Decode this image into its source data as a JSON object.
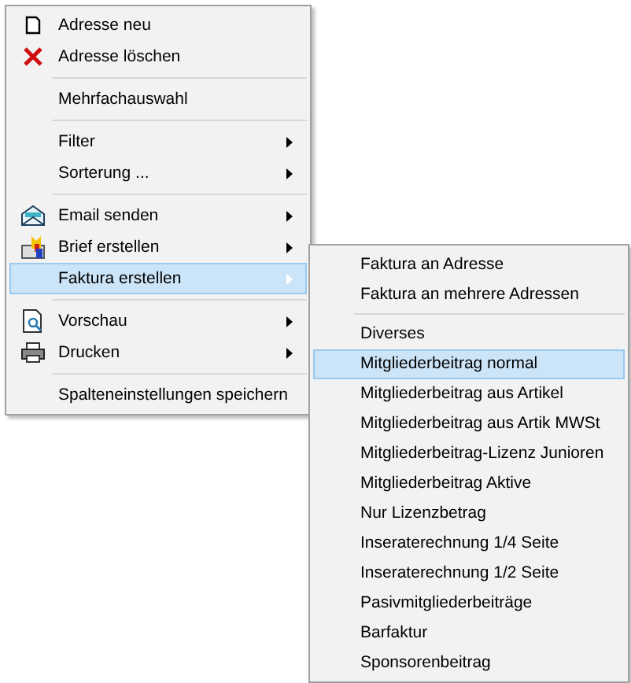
{
  "menu": {
    "items": [
      {
        "kind": "item",
        "label": "Adresse neu",
        "has_submenu": false,
        "selected": false
      },
      {
        "kind": "item",
        "label": "Adresse löschen",
        "has_submenu": false,
        "selected": false
      },
      {
        "kind": "separator"
      },
      {
        "kind": "item",
        "label": "Mehrfachauswahl",
        "has_submenu": false,
        "selected": false
      },
      {
        "kind": "separator"
      },
      {
        "kind": "item",
        "label": "Filter",
        "has_submenu": true,
        "selected": false
      },
      {
        "kind": "item",
        "label": "Sorterung ...",
        "has_submenu": true,
        "selected": false
      },
      {
        "kind": "separator"
      },
      {
        "kind": "item",
        "label": "Email senden",
        "has_submenu": true,
        "selected": false
      },
      {
        "kind": "item",
        "label": "Brief erstellen",
        "has_submenu": true,
        "selected": false
      },
      {
        "kind": "item",
        "label": "Faktura erstellen",
        "has_submenu": true,
        "selected": true
      },
      {
        "kind": "separator"
      },
      {
        "kind": "item",
        "label": "Vorschau",
        "has_submenu": true,
        "selected": false
      },
      {
        "kind": "item",
        "label": "Drucken",
        "has_submenu": true,
        "selected": false
      },
      {
        "kind": "separator"
      },
      {
        "kind": "item",
        "label": "Spalteneinstellungen speichern",
        "has_submenu": false,
        "selected": false
      }
    ]
  },
  "submenu": {
    "items": [
      {
        "kind": "item",
        "label": "Faktura an Adresse",
        "selected": false
      },
      {
        "kind": "item",
        "label": "Faktura an mehrere Adressen",
        "selected": false
      },
      {
        "kind": "separator"
      },
      {
        "kind": "item",
        "label": "Diverses",
        "selected": false
      },
      {
        "kind": "item",
        "label": "Mitgliederbeitrag normal",
        "selected": true
      },
      {
        "kind": "item",
        "label": "Mitgliederbeitrag aus Artikel",
        "selected": false
      },
      {
        "kind": "item",
        "label": "Mitgliederbeitrag aus Artik MWSt",
        "selected": false
      },
      {
        "kind": "item",
        "label": "Mitgliederbeitrag-Lizenz Junioren",
        "selected": false
      },
      {
        "kind": "item",
        "label": "Mitgliederbeitrag Aktive",
        "selected": false
      },
      {
        "kind": "item",
        "label": "Nur Lizenzbetrag",
        "selected": false
      },
      {
        "kind": "item",
        "label": "Inseraterechnung 1/4 Seite",
        "selected": false
      },
      {
        "kind": "item",
        "label": "Inseraterechnung 1/2 Seite",
        "selected": false
      },
      {
        "kind": "item",
        "label": "Pasivmitgliederbeiträge",
        "selected": false
      },
      {
        "kind": "item",
        "label": "Barfaktur",
        "selected": false
      },
      {
        "kind": "item",
        "label": "Sponsorenbeitrag",
        "selected": false
      }
    ]
  }
}
